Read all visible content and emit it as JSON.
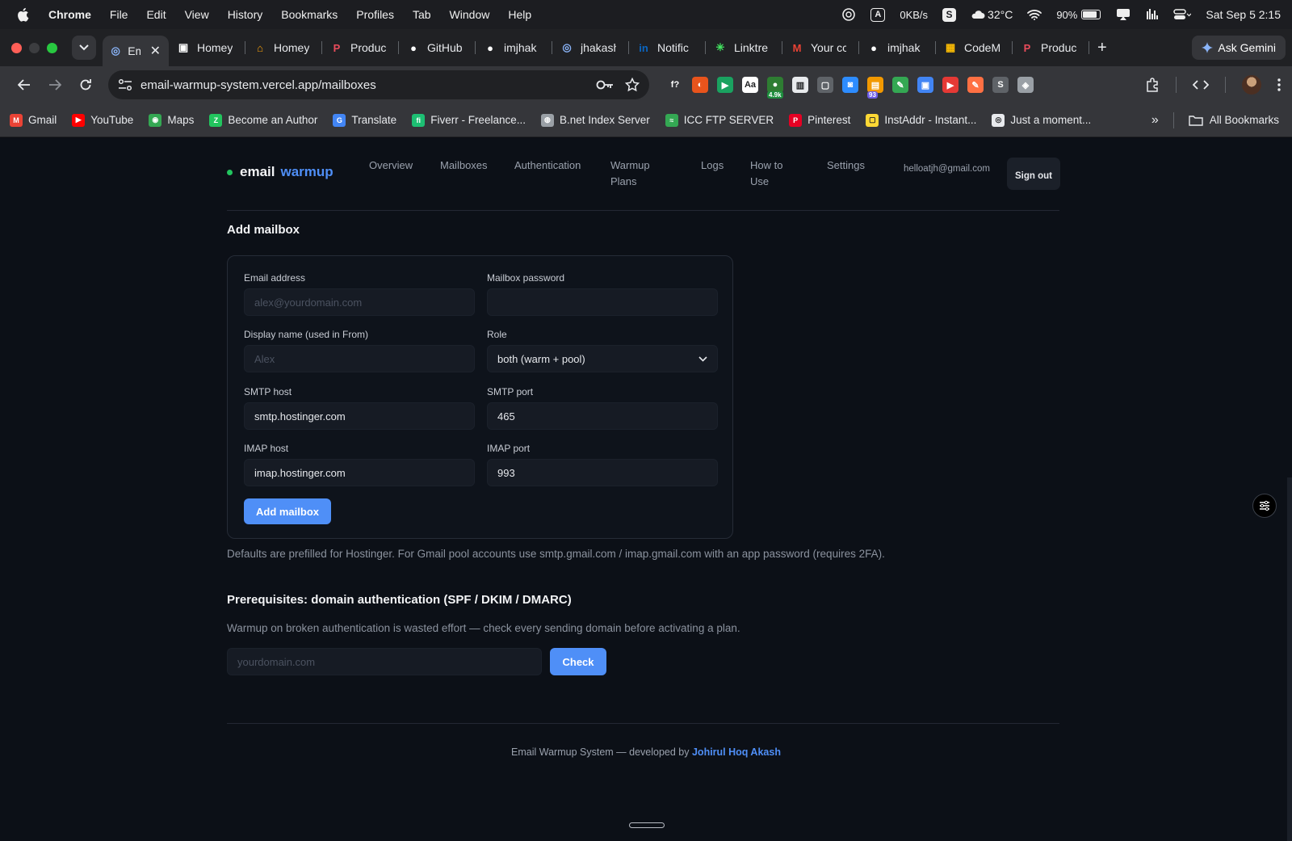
{
  "menubar": {
    "app": "Chrome",
    "items": [
      "File",
      "Edit",
      "View",
      "History",
      "Bookmarks",
      "Profiles",
      "Tab",
      "Window",
      "Help"
    ],
    "a_indicator": "A",
    "net_speed": "0KB/s",
    "s_indicator": "S",
    "weather": "32°C",
    "battery": "90%",
    "datetime": "Sat Sep 5  2:15"
  },
  "tabs": [
    {
      "label": "Em",
      "color": "#8ab4f8",
      "glyph": "◎"
    },
    {
      "label": "Homey",
      "color": "#ffffff",
      "glyph": "▣"
    },
    {
      "label": "Homey",
      "color": "#f59e0b",
      "glyph": "⌂"
    },
    {
      "label": "Produc",
      "color": "#ea4c5b",
      "glyph": "P"
    },
    {
      "label": "GitHub",
      "color": "#ffffff",
      "glyph": "●"
    },
    {
      "label": "imjhak",
      "color": "#ffffff",
      "glyph": "●"
    },
    {
      "label": "jhakash",
      "color": "#8ab4f8",
      "glyph": "◎"
    },
    {
      "label": "Notific",
      "color": "#0a66c2",
      "glyph": "in"
    },
    {
      "label": "Linktre",
      "color": "#43e660",
      "glyph": "✳"
    },
    {
      "label": "Your cc",
      "color": "#ea4335",
      "glyph": "M"
    },
    {
      "label": "imjhak",
      "color": "#ffffff",
      "glyph": "●"
    },
    {
      "label": "CodeM",
      "color": "#fbbc04",
      "glyph": "▦"
    },
    {
      "label": "Produc",
      "color": "#ea4c5b",
      "glyph": "P"
    }
  ],
  "gemini_label": "Ask Gemini",
  "address": "email-warmup-system.vercel.app/mailboxes",
  "extensions": [
    {
      "glyph": "f?",
      "color": "transparent"
    },
    {
      "glyph": "◐",
      "color": "#e8541c"
    },
    {
      "glyph": "▶",
      "color": "#1aa260"
    },
    {
      "glyph": "Aa",
      "color": "#ffffff"
    },
    {
      "glyph": "●",
      "color": "#2e7d32",
      "badge": "4.9k",
      "badge_color": "#1e8e3e"
    },
    {
      "glyph": "▥",
      "color": "#e8eaed"
    },
    {
      "glyph": "▢",
      "color": "#5f6368"
    },
    {
      "glyph": "◙",
      "color": "#2d8cff"
    },
    {
      "glyph": "▤",
      "color": "#f29900",
      "badge": "93",
      "badge_color": "#6c5ce7"
    },
    {
      "glyph": "✎",
      "color": "#34a853"
    },
    {
      "glyph": "▣",
      "color": "#4285f4"
    },
    {
      "glyph": "▶",
      "color": "#e53935"
    },
    {
      "glyph": "✎",
      "color": "#ff7043"
    },
    {
      "glyph": "S",
      "color": "#5f6368"
    },
    {
      "glyph": "◈",
      "color": "#9aa0a6"
    }
  ],
  "bookmarks": [
    {
      "label": "Gmail",
      "color": "#ea4335",
      "glyph": "M"
    },
    {
      "label": "YouTube",
      "color": "#ff0000",
      "glyph": "▶"
    },
    {
      "label": "Maps",
      "color": "#34a853",
      "glyph": "◉"
    },
    {
      "label": "Become an Author",
      "color": "#22c55e",
      "glyph": "Z"
    },
    {
      "label": "Translate",
      "color": "#4285f4",
      "glyph": "G"
    },
    {
      "label": "Fiverr - Freelance...",
      "color": "#1dbf73",
      "glyph": "fi"
    },
    {
      "label": "B.net Index Server",
      "color": "#9aa0a6",
      "glyph": "◍"
    },
    {
      "label": "ICC FTP SERVER",
      "color": "#34a853",
      "glyph": "≈"
    },
    {
      "label": "Pinterest",
      "color": "#e60023",
      "glyph": "P"
    },
    {
      "label": "InstAddr - Instant...",
      "color": "#fdd835",
      "glyph": "▢"
    },
    {
      "label": "Just a moment...",
      "color": "#e8eaed",
      "glyph": "◎"
    }
  ],
  "all_bookmarks": "All Bookmarks",
  "app": {
    "brand_word1": "email",
    "brand_word2": "warmup",
    "nav": [
      "Overview",
      "Mailboxes",
      "Authentication",
      "Warmup Plans",
      "Logs",
      "How to Use",
      "Settings"
    ],
    "user_email": "helloatjh@gmail.com",
    "signout": "Sign out"
  },
  "add_mailbox": {
    "title": "Add mailbox",
    "email_label": "Email address",
    "email_placeholder": "alex@yourdomain.com",
    "password_label": "Mailbox password",
    "display_label": "Display name (used in From)",
    "display_placeholder": "Alex",
    "role_label": "Role",
    "role_value": "both (warm + pool)",
    "smtp_host_label": "SMTP host",
    "smtp_host": "smtp.hostinger.com",
    "smtp_port_label": "SMTP port",
    "smtp_port": "465",
    "imap_host_label": "IMAP host",
    "imap_host": "imap.hostinger.com",
    "imap_port_label": "IMAP port",
    "imap_port": "993",
    "submit": "Add mailbox",
    "note": "Defaults are prefilled for Hostinger. For Gmail pool accounts use smtp.gmail.com / imap.gmail.com with an app password (requires 2FA)."
  },
  "prereq": {
    "title": "Prerequisites: domain authentication (SPF / DKIM / DMARC)",
    "desc": "Warmup on broken authentication is wasted effort — check every sending domain before activating a plan.",
    "domain_placeholder": "yourdomain.com",
    "check": "Check"
  },
  "footer": {
    "text": "Email Warmup System — developed by",
    "author": "Johirul Hoq Akash"
  },
  "colors": {
    "accent": "#4f8ff7",
    "status_dot": "#22c55e",
    "page_bg": "#0c1017"
  }
}
